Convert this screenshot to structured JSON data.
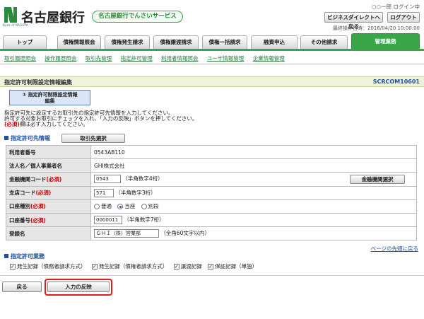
{
  "header": {
    "bank_name": "名古屋銀行",
    "logo_sub": "Bank of NAGOYA",
    "service_name": "名古屋銀行でんさいサービス",
    "logged_in": "○○一郎 ログイン中",
    "direct_button": "ビジネスダイレクトへ戻る",
    "logout_button": "ログアウト",
    "last_operation": "最終操作日時：2016/04/20 10:00:00"
  },
  "tabs": [
    "トップ",
    "債権情報照会",
    "債権発生請求",
    "債権譲渡請求",
    "債権一括請求",
    "融資申込",
    "その他請求",
    "管理業務"
  ],
  "subnav": [
    "取引履歴照会",
    "操作履歴照会",
    "取引先管理",
    "指定許可管理",
    "利用者情報照会",
    "ユーザ情報管理",
    "企業情報管理"
  ],
  "title": {
    "text": "指定許可制限設定情報編集",
    "code": "SCRCOM10601"
  },
  "step": {
    "line1": "① 指定許可制限設定情報",
    "line2": "編集"
  },
  "intro": {
    "line1": "指定許可先に設定するお取引先の指定許可先情報を入力してください。",
    "line2": "許可する対象お取引にチェックを入れ、「入力の反映」ボタンを押してください。",
    "req_mark": "(必須)",
    "line3_rest": "欄は必ず入力してください。"
  },
  "section1": {
    "title": "指定許可先情報",
    "select_button": "取引先選択"
  },
  "form": {
    "user_no_label": "利用者番号",
    "user_no_value": "0543AB110",
    "name_label": "法人名／個人事業者名",
    "name_value": "GHI株式会社",
    "required_suffix": "(必須)",
    "bank_code_label": "金融機関コード",
    "bank_code_value": "0543",
    "bank_code_hint": "（半角数字4桁）",
    "bank_select_button": "金融機関選択",
    "branch_label": "支店コード",
    "branch_value": "571",
    "branch_hint": "（半角数字3桁）",
    "acct_type_label": "口座種別",
    "acct_type_options": [
      "普通",
      "当座",
      "別段"
    ],
    "acct_no_label": "口座番号",
    "acct_no_value": "0000011",
    "acct_no_hint": "（半角数字7桁）",
    "reg_name_label": "登録名",
    "reg_name_value": "ＧＨＩ（株）営業部",
    "reg_name_hint": "（全角60文字以内）"
  },
  "page_top_link": "ページの先頭に戻る",
  "section2": {
    "title": "指定許可業務",
    "items": [
      "発生記録（債務者請求方式）",
      "発生記録（債権者請求方式）",
      "譲渡記録",
      "保証記録（単独）"
    ]
  },
  "footer": {
    "back_button": "戻る",
    "apply_button": "入力の反映"
  },
  "colors": {
    "brand_green": "#3aa64a",
    "link_blue": "#1f4fa0",
    "required_red": "#d00000",
    "highlight_red": "#e21a1a"
  }
}
